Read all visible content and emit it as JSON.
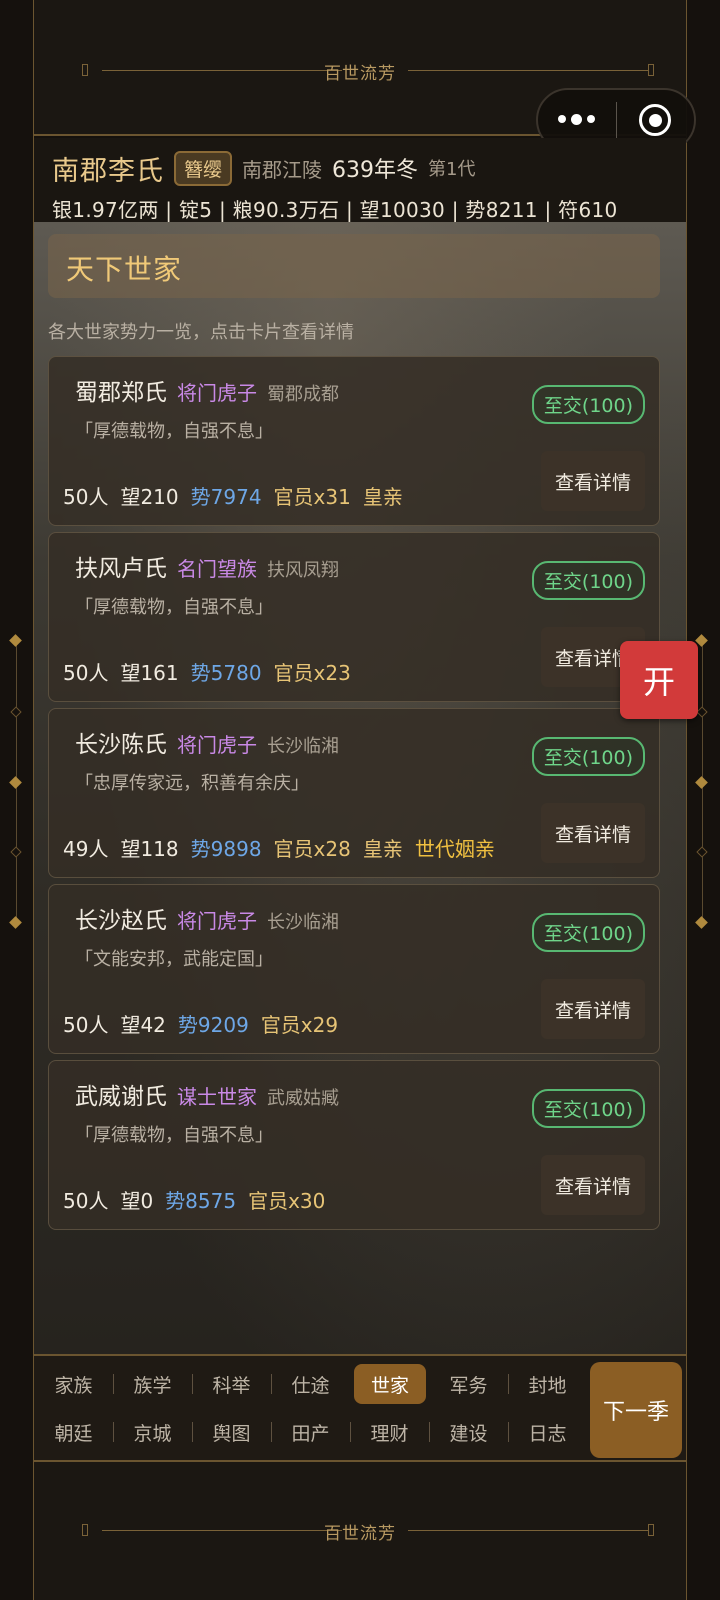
{
  "banner_title": "百世流芳",
  "header": {
    "clan_name": "南郡李氏",
    "rank": "簪缨",
    "location": "南郡江陵",
    "year": "639年冬",
    "generation": "第1代",
    "resources": "银1.97亿两 | 锭5 | 粮90.3万石 | 望10030 | 势8211 | 符610"
  },
  "section": {
    "title": "天下世家",
    "subtitle": "各大世家势力一览，点击卡片查看详情"
  },
  "detail_label": "查看详情",
  "families": [
    {
      "name": "蜀郡郑氏",
      "type": "将门虎子",
      "place": "蜀郡成都",
      "motto": "「厚德载物，自强不息」",
      "relation": "至交(100)",
      "people": "50人",
      "fame": "望210",
      "power": "势7974",
      "officials": "官员x31",
      "tag1": "皇亲",
      "tag2": ""
    },
    {
      "name": "扶风卢氏",
      "type": "名门望族",
      "place": "扶风凤翔",
      "motto": "「厚德载物，自强不息」",
      "relation": "至交(100)",
      "people": "50人",
      "fame": "望161",
      "power": "势5780",
      "officials": "官员x23",
      "tag1": "",
      "tag2": ""
    },
    {
      "name": "长沙陈氏",
      "type": "将门虎子",
      "place": "长沙临湘",
      "motto": "「忠厚传家远，积善有余庆」",
      "relation": "至交(100)",
      "people": "49人",
      "fame": "望118",
      "power": "势9898",
      "officials": "官员x28",
      "tag1": "皇亲",
      "tag2": "世代姻亲"
    },
    {
      "name": "长沙赵氏",
      "type": "将门虎子",
      "place": "长沙临湘",
      "motto": "「文能安邦，武能定国」",
      "relation": "至交(100)",
      "people": "50人",
      "fame": "望42",
      "power": "势9209",
      "officials": "官员x29",
      "tag1": "",
      "tag2": ""
    },
    {
      "name": "武威谢氏",
      "type": "谋士世家",
      "place": "武威姑臧",
      "motto": "「厚德载物，自强不息」",
      "relation": "至交(100)",
      "people": "50人",
      "fame": "望0",
      "power": "势8575",
      "officials": "官员x30",
      "tag1": "",
      "tag2": ""
    }
  ],
  "float_button": "开",
  "tabs_row1": [
    "家族",
    "族学",
    "科举",
    "仕途",
    "世家",
    "军务",
    "封地"
  ],
  "tabs_row2": [
    "朝廷",
    "京城",
    "舆图",
    "田产",
    "理财",
    "建设",
    "日志"
  ],
  "active_tab": "世家",
  "next_season": "下一季",
  "colors": {
    "accent_gold": "#e9c98c",
    "relation_green": "#6fd58a",
    "power_blue": "#6ea7e6",
    "type_purple": "#c989e6",
    "active_tab": "#8b5e24",
    "float_red": "#d23a3a"
  }
}
